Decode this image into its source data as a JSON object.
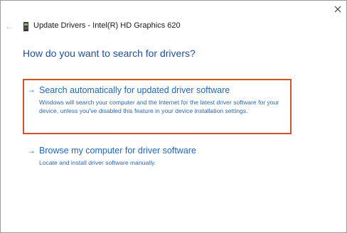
{
  "window": {
    "title": "Update Drivers - Intel(R) HD Graphics 620",
    "back_icon": "back-arrow-icon",
    "device_icon": "graphics-card-icon",
    "close_icon": "close-icon"
  },
  "main": {
    "heading": "How do you want to search for drivers?",
    "options": [
      {
        "icon": "arrow-right-icon",
        "title": "Search automatically for updated driver software",
        "description": "Windows will search your computer and the Internet for the latest driver software for your device, unless you've disabled this feature in your device installation settings."
      },
      {
        "icon": "arrow-right-icon",
        "title": "Browse my computer for driver software",
        "description": "Locate and install driver software manually."
      }
    ]
  },
  "colors": {
    "heading": "#1f4e9c",
    "link": "#1f67c2",
    "highlight_border": "#d0532b"
  }
}
